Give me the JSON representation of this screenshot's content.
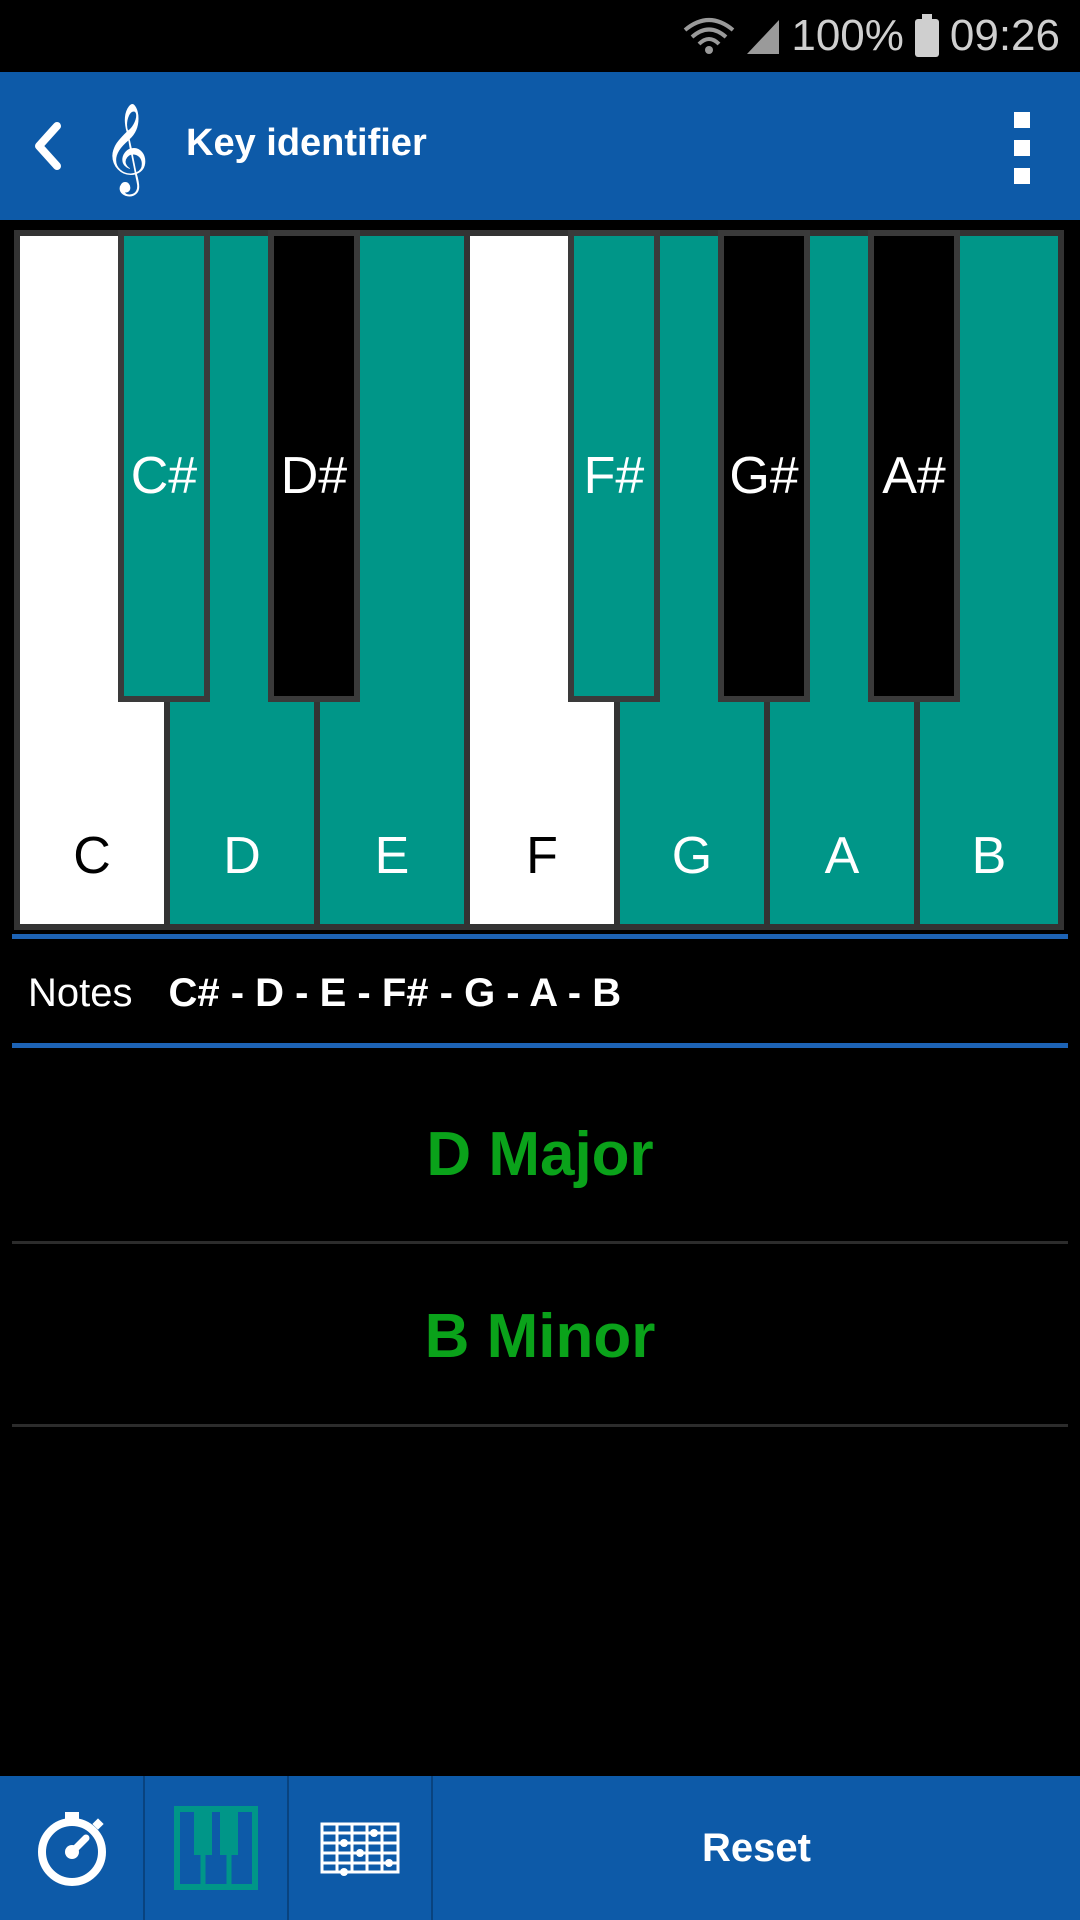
{
  "status": {
    "battery": "100%",
    "time": "09:26"
  },
  "appbar": {
    "title": "Key identifier",
    "back_icon": "back-chevron-icon",
    "app_icon": "treble-clef-icon",
    "overflow_icon": "overflow-menu-icon"
  },
  "keyboard": {
    "white_keys": [
      {
        "label": "C",
        "active": false
      },
      {
        "label": "D",
        "active": true
      },
      {
        "label": "E",
        "active": true
      },
      {
        "label": "F",
        "active": false
      },
      {
        "label": "G",
        "active": true
      },
      {
        "label": "A",
        "active": true
      },
      {
        "label": "B",
        "active": true
      }
    ],
    "black_keys": [
      {
        "label": "C#",
        "active": true
      },
      {
        "label": "D#",
        "active": false
      },
      {
        "label": "F#",
        "active": true
      },
      {
        "label": "G#",
        "active": false
      },
      {
        "label": "A#",
        "active": false
      }
    ],
    "active_color": "#009688"
  },
  "notes": {
    "label": "Notes",
    "value": "C# - D - E - F# - G - A - B"
  },
  "results": [
    "D Major",
    "B Minor"
  ],
  "bottombar": {
    "reset_label": "Reset",
    "tuner_icon": "tuner-dial-icon",
    "piano_icon": "piano-keys-icon",
    "fretboard_icon": "guitar-fretboard-icon"
  }
}
